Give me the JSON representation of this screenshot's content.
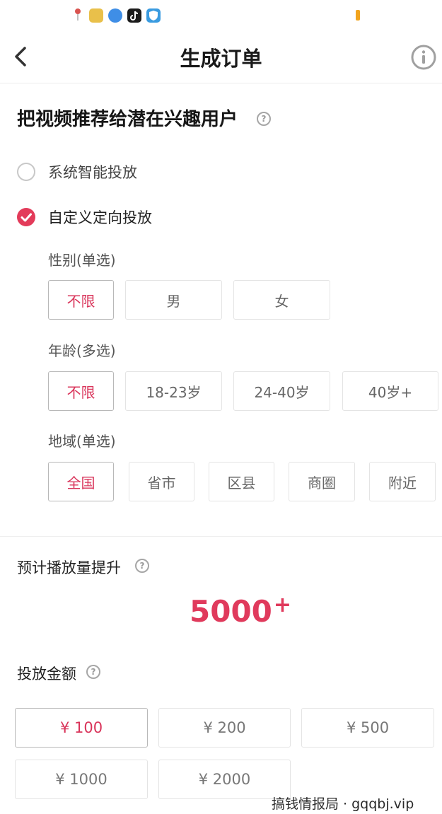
{
  "nav": {
    "title": "生成订单",
    "back_icon": "chevron-left-icon",
    "info_icon": "info-icon"
  },
  "status_bar": {
    "app_icons": [
      "map-pin-icon",
      "gallery-app-icon",
      "browser-app-icon",
      "tiktok-app-icon",
      "shield-app-icon"
    ],
    "battery_color": "#f2a41e"
  },
  "targeting": {
    "heading": "把视频推荐给潜在兴趣用户",
    "help_icon": "question-circle-icon",
    "options": [
      {
        "label": "系统智能投放",
        "checked": false
      },
      {
        "label": "自定义定向投放",
        "checked": true
      }
    ],
    "gender": {
      "label": "性别(单选)",
      "choices": [
        "不限",
        "男",
        "女"
      ],
      "selected": "不限"
    },
    "age": {
      "label": "年龄(多选)",
      "choices": [
        "不限",
        "18-23岁",
        "24-40岁",
        "40岁+"
      ],
      "selected": "不限"
    },
    "region": {
      "label": "地域(单选)",
      "choices": [
        "全国",
        "省市",
        "区县",
        "商圈",
        "附近"
      ],
      "selected": "全国"
    }
  },
  "estimate": {
    "label": "预计播放量提升",
    "value": "5000",
    "suffix": "+"
  },
  "budget": {
    "label": "投放金额",
    "amounts": [
      "¥ 100",
      "¥ 200",
      "¥ 500",
      "¥ 1000",
      "¥ 2000"
    ],
    "selected": "¥ 100"
  },
  "watermark": "搞钱情报局 · gqqbj.vip",
  "colors": {
    "accent": "#e03a5c",
    "selected_text": "#d9345a",
    "border": "#e4e4e4"
  }
}
